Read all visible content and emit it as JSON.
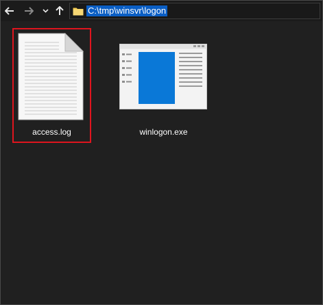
{
  "nav": {
    "back_icon": "arrow-left-icon",
    "forward_icon": "arrow-right-icon",
    "recent_icon": "chevron-down-icon",
    "up_icon": "arrow-up-icon"
  },
  "address_bar": {
    "path": "C:\\tmp\\winsvr\\logon",
    "folder_icon": "folder-icon",
    "highlight_color": "#0a5ec4"
  },
  "files": [
    {
      "name": "access.log",
      "icon": "document-icon",
      "selected": true
    },
    {
      "name": "winlogon.exe",
      "icon": "application-window-icon",
      "selected": false
    }
  ],
  "colors": {
    "background": "#202020",
    "selection_border": "#e0151e",
    "app_accent": "#0a78d7"
  }
}
